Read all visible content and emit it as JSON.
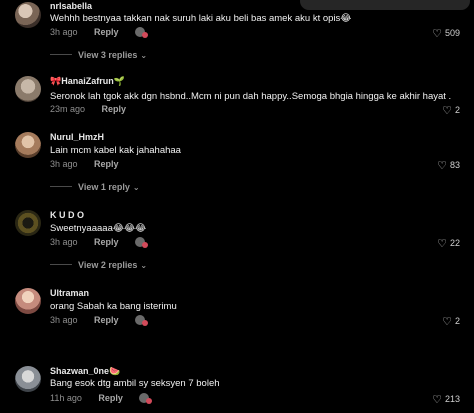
{
  "comments": [
    {
      "username": "nrlsabella",
      "user_emoji": "",
      "text": "Wehhh bestnyaa takkan nak suruh laki aku beli bas amek aku kt opis😂",
      "time": "3h ago",
      "reply_label": "Reply",
      "likes": "509",
      "view_replies": "View 3 replies"
    },
    {
      "username": "HanaiZafrun",
      "user_emoji_before": "🎀",
      "user_emoji": "🌱",
      "text": "Seronok lah tgok akk dgn hsbnd..Mcm ni pun dah happy..Semoga bhgia hingga ke akhir hayat .",
      "time": "23m ago",
      "reply_label": "Reply",
      "likes": "2"
    },
    {
      "username": "Nurul_HmzH",
      "user_emoji": "",
      "text": "Lain mcm kabel kak jahahahaa",
      "time": "3h ago",
      "reply_label": "Reply",
      "likes": "83",
      "view_replies": "View 1 reply"
    },
    {
      "username": "K U D O",
      "user_emoji": "",
      "text": "Sweetnyaaaaa😂😂😂",
      "time": "3h ago",
      "reply_label": "Reply",
      "likes": "22",
      "view_replies": "View 2 replies"
    },
    {
      "username": "Ultraman",
      "user_emoji": "",
      "text": "orang Sabah ka bang isterimu",
      "time": "3h ago",
      "reply_label": "Reply",
      "likes": "2"
    },
    {
      "username": "Shazwan_0ne",
      "user_emoji": "🍉",
      "text": "Bang esok dtg ambil sy seksyen 7 boleh",
      "time": "11h ago",
      "reply_label": "Reply",
      "likes": "213"
    }
  ],
  "icons": {
    "heart": "heart-outline-icon",
    "chevron": "chevron-down-icon",
    "reaction": "reaction-sticker-icon"
  }
}
